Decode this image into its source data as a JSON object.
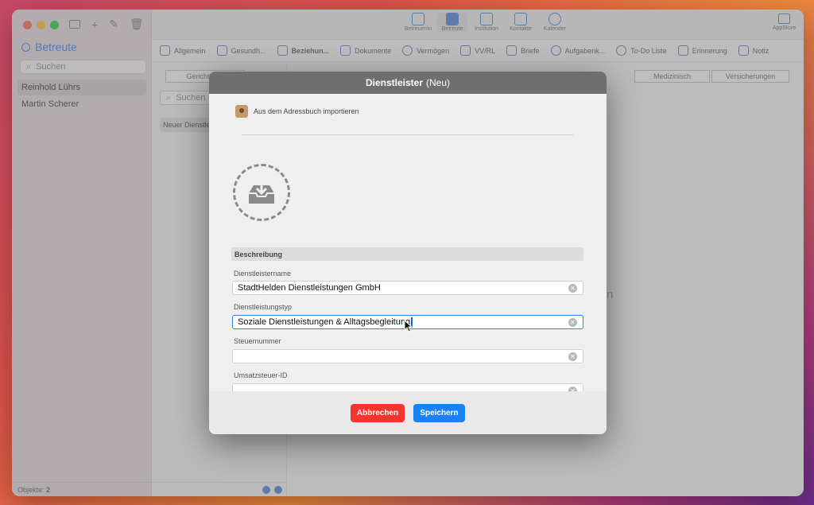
{
  "window": {
    "traffic_colors": [
      "#ff5f57",
      "#febc2e",
      "#28c840"
    ]
  },
  "sidebar": {
    "title": "Betreute",
    "search_placeholder": "Suchen",
    "items": [
      {
        "label": "Reinhold Lührs",
        "selected": true
      },
      {
        "label": "Martin Scherer",
        "selected": false
      }
    ],
    "status_label": "Objekte:",
    "status_count": "2"
  },
  "toolbar": {
    "buttons": [
      {
        "label": "Betreuer/in",
        "icon": "person-icon"
      },
      {
        "label": "Betreute",
        "icon": "person-filled-icon",
        "active": true
      },
      {
        "label": "Institution",
        "icon": "institution-icon"
      },
      {
        "label": "Kontakte",
        "icon": "contacts-icon"
      },
      {
        "label": "Kalender",
        "icon": "alarm-clock-icon"
      }
    ],
    "appstore_label": "AppStore"
  },
  "categories": [
    {
      "label": "Allgemein"
    },
    {
      "label": "Gesundh..."
    },
    {
      "label": "Beziehun...",
      "bold": true
    },
    {
      "label": "Dokumente"
    },
    {
      "label": "Vermögen"
    },
    {
      "label": "VV/RL"
    },
    {
      "label": "Briefe"
    },
    {
      "label": "Aufgabenk..."
    },
    {
      "label": "To-Do Liste"
    },
    {
      "label": "Erinnerung"
    },
    {
      "label": "Notiz"
    }
  ],
  "segments": {
    "left": "Gerichtl. Be",
    "medizinisch": "Medizinisch",
    "versicherungen": "Versicherungen"
  },
  "mid": {
    "search_placeholder": "Suchen",
    "new_item": "Neuer Dienstlei",
    "background_text": "n"
  },
  "modal": {
    "title": "Dienstleister",
    "title_suffix": "(Neu)",
    "import_label": "Aus dem Adressbuch importieren",
    "section_label": "Beschreibung",
    "fields": {
      "name_label": "Dienstleistername",
      "name_value": "StadtHelden Dienstleistungen GmbH",
      "type_label": "Dienstleistungstyp",
      "type_value": "Soziale Dienstleistungen & Alltagsbegleitung",
      "tax_label": "Steuernummer",
      "tax_value": "",
      "vat_label": "Umsatzsteuer-ID",
      "vat_value": ""
    },
    "cancel_label": "Abbrechen",
    "save_label": "Speichern"
  }
}
